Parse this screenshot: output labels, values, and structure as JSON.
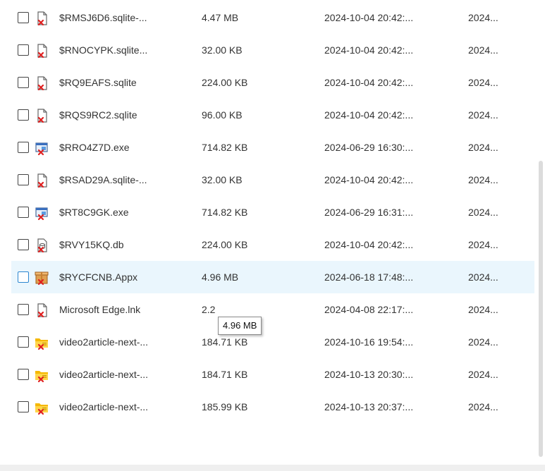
{
  "rows": [
    {
      "name": "$RMSJ6D6.sqlite-...",
      "size": "4.47 MB",
      "date": "2024-10-04 20:42:...",
      "extra": "2024...",
      "icon": "deleted-file-icon"
    },
    {
      "name": "$RNOCYPK.sqlite...",
      "size": "32.00 KB",
      "date": "2024-10-04 20:42:...",
      "extra": "2024...",
      "icon": "deleted-file-icon"
    },
    {
      "name": "$RQ9EAFS.sqlite",
      "size": "224.00 KB",
      "date": "2024-10-04 20:42:...",
      "extra": "2024...",
      "icon": "deleted-file-icon"
    },
    {
      "name": "$RQS9RC2.sqlite",
      "size": "96.00 KB",
      "date": "2024-10-04 20:42:...",
      "extra": "2024...",
      "icon": "deleted-file-icon"
    },
    {
      "name": "$RRO4Z7D.exe",
      "size": "714.82 KB",
      "date": "2024-06-29 16:30:...",
      "extra": "2024...",
      "icon": "deleted-exe-icon"
    },
    {
      "name": "$RSAD29A.sqlite-...",
      "size": "32.00 KB",
      "date": "2024-10-04 20:42:...",
      "extra": "2024...",
      "icon": "deleted-file-icon"
    },
    {
      "name": "$RT8C9GK.exe",
      "size": "714.82 KB",
      "date": "2024-06-29 16:31:...",
      "extra": "2024...",
      "icon": "deleted-exe-icon"
    },
    {
      "name": "$RVY15KQ.db",
      "size": "224.00 KB",
      "date": "2024-10-04 20:42:...",
      "extra": "2024...",
      "icon": "deleted-db-icon"
    },
    {
      "name": "$RYCFCNB.Appx",
      "size": "4.96 MB",
      "date": "2024-06-18 17:48:...",
      "extra": "2024...",
      "icon": "deleted-package-icon",
      "hover": true
    },
    {
      "name": "Microsoft Edge.lnk",
      "size": "2.2",
      "date": "2024-04-08 22:17:...",
      "extra": "2024...",
      "icon": "deleted-file-icon"
    },
    {
      "name": "video2article-next-...",
      "size": "184.71 KB",
      "date": "2024-10-16 19:54:...",
      "extra": "2024...",
      "icon": "deleted-folder-icon"
    },
    {
      "name": "video2article-next-...",
      "size": "184.71 KB",
      "date": "2024-10-13 20:30:...",
      "extra": "2024...",
      "icon": "deleted-folder-icon"
    },
    {
      "name": "video2article-next-...",
      "size": "185.99 KB",
      "date": "2024-10-13 20:37:...",
      "extra": "2024...",
      "icon": "deleted-folder-icon"
    }
  ],
  "tooltip": {
    "text": "4.96 MB"
  },
  "colors": {
    "hover_row": "#eaf6fd",
    "deleted_mark": "#e02020",
    "folder": "#f5b800",
    "checkbox_hover": "#2c86d0"
  }
}
